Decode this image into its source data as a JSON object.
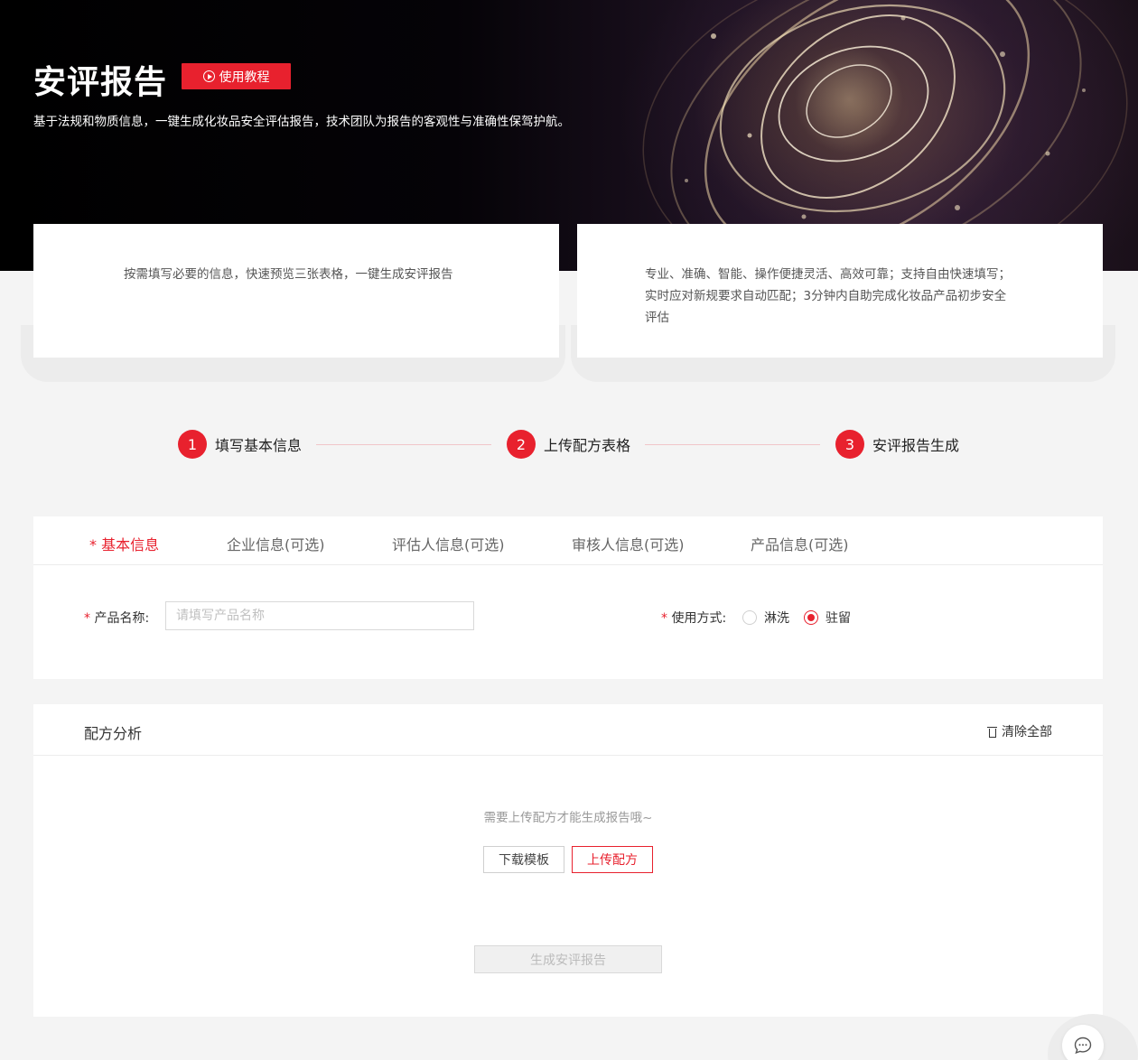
{
  "hero": {
    "title": "安评报告",
    "tutorial_label": "使用教程",
    "description": "基于法规和物质信息，一键生成化妆品安全评估报告，技术团队为报告的客观性与准确性保驾护航。"
  },
  "features": [
    {
      "text": "按需填写必要的信息，快速预览三张表格，一键生成安评报告"
    },
    {
      "text": "专业、准确、智能、操作便捷灵活、高效可靠；支持自由快速填写；实时应对新规要求自动匹配；3分钟内自助完成化妆品产品初步安全评估"
    }
  ],
  "steps": [
    {
      "num": "1",
      "label": "填写基本信息"
    },
    {
      "num": "2",
      "label": "上传配方表格"
    },
    {
      "num": "3",
      "label": "安评报告生成"
    }
  ],
  "tabs": [
    {
      "marker": "*",
      "label": "基本信息",
      "active": true
    },
    {
      "label": "企业信息(可选)"
    },
    {
      "label": "评估人信息(可选)"
    },
    {
      "label": "审核人信息(可选)"
    },
    {
      "label": "产品信息(可选)"
    }
  ],
  "basic_form": {
    "required_marker": "*",
    "product_name_label": "产品名称:",
    "product_name_placeholder": "请填写产品名称",
    "product_name_value": "",
    "usage_label": "使用方式:",
    "usage_options": [
      "淋洗",
      "驻留"
    ],
    "usage_selected": "驻留"
  },
  "formula": {
    "title": "配方分析",
    "clear_label": "清除全部",
    "empty_tip": "需要上传配方才能生成报告哦~",
    "download_label": "下载模板",
    "upload_label": "上传配方",
    "generate_label": "生成安评报告"
  },
  "colors": {
    "accent": "#e8212e",
    "background": "#f4f4f4",
    "hero_dark": "#000000"
  }
}
